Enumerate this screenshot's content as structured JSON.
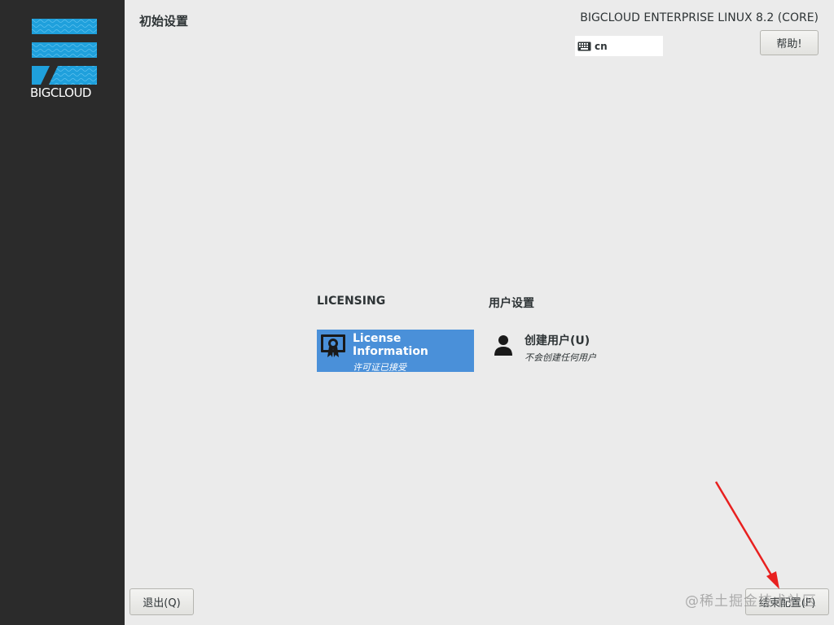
{
  "sidebar": {
    "logo_text": "BIGCLOUD",
    "logo_color": "#1fa0dc"
  },
  "header": {
    "page_title": "初始设置",
    "product_title": "BIGCLOUD ENTERPRISE LINUX 8.2 (CORE)",
    "keyboard_layout": "cn",
    "help_label": "帮助!"
  },
  "sections": [
    {
      "heading": "LICENSING",
      "spokes": [
        {
          "title": "License Information",
          "status": "许可证已接受",
          "icon": "license-certificate-icon",
          "selected": true
        }
      ]
    },
    {
      "heading": "用户设置",
      "spokes": [
        {
          "title": "创建用户(U)",
          "status": "不会创建任何用户",
          "icon": "user-icon",
          "selected": false
        }
      ]
    }
  ],
  "footer": {
    "quit_label": "退出(Q)",
    "finish_label": "结束配置(F)"
  },
  "watermark": "@稀土掘金技术社区",
  "colors": {
    "accent": "#4a90d9",
    "annotation_arrow": "#e8201f"
  }
}
